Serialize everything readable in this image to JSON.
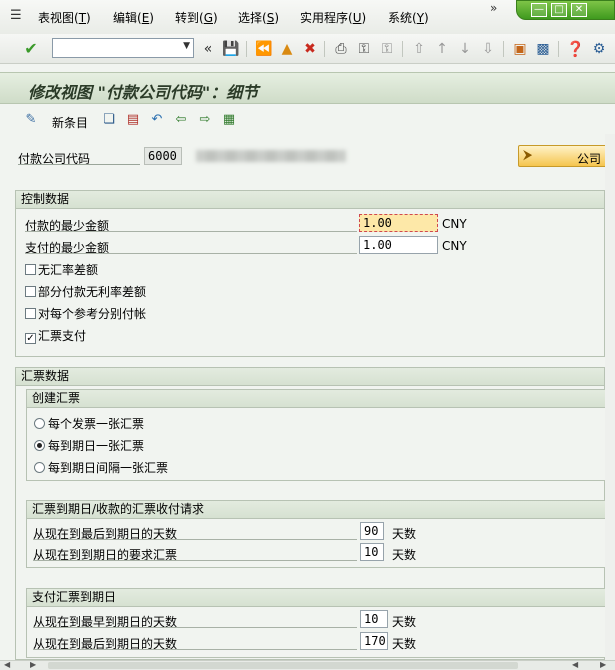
{
  "menu": {
    "items": [
      {
        "label": "表视图(",
        "mn": "T",
        "tail": ")"
      },
      {
        "label": "编辑(",
        "mn": "E",
        "tail": ")"
      },
      {
        "label": "转到(",
        "mn": "G",
        "tail": ")"
      },
      {
        "label": "选择(",
        "mn": "S",
        "tail": ")"
      },
      {
        "label": "实用程序(",
        "mn": "U",
        "tail": ")"
      },
      {
        "label": "系统(",
        "mn": "Y",
        "tail": ")"
      }
    ],
    "overflow": "»"
  },
  "toolbar": {
    "command_value": ""
  },
  "title": "修改视图 \"付款公司代码\"：细节",
  "app_toolbar": {
    "new_entries_label": "新条目"
  },
  "company": {
    "label": "付款公司代码",
    "code": "6000",
    "button_label": "公司"
  },
  "control": {
    "title": "控制数据",
    "min_payment_label": "付款的最少金额",
    "min_payment_value": "1.00",
    "min_payment_unit": "CNY",
    "min_pay_label": "支付的最少金额",
    "min_pay_value": "1.00",
    "min_pay_unit": "CNY",
    "checkboxes": [
      {
        "label": "无汇率差额",
        "checked": false
      },
      {
        "label": "部分付款无利率差额",
        "checked": false
      },
      {
        "label": "对每个参考分别付帐",
        "checked": false
      },
      {
        "label": "汇票支付",
        "checked": true
      }
    ]
  },
  "bill": {
    "title": "汇票数据",
    "create": {
      "title": "创建汇票",
      "options": [
        {
          "label": "每个发票一张汇票",
          "selected": false
        },
        {
          "label": "每到期日一张汇票",
          "selected": true
        },
        {
          "label": "每到期日间隔一张汇票",
          "selected": false
        }
      ]
    },
    "due": {
      "title": "汇票到期日/收款的汇票收付请求",
      "rows": [
        {
          "label": "从现在到最后到期日的天数",
          "value": "90",
          "unit": "天数"
        },
        {
          "label": "从现在到到期日的要求汇票",
          "value": "10",
          "unit": "天数"
        }
      ]
    },
    "pay_due": {
      "title": "支付汇票到期日",
      "rows": [
        {
          "label": "从现在到最早到期日的天数",
          "value": "10",
          "unit": "天数"
        },
        {
          "label": "从现在到最后到期日的天数",
          "value": "170",
          "unit": "天数"
        }
      ]
    }
  }
}
